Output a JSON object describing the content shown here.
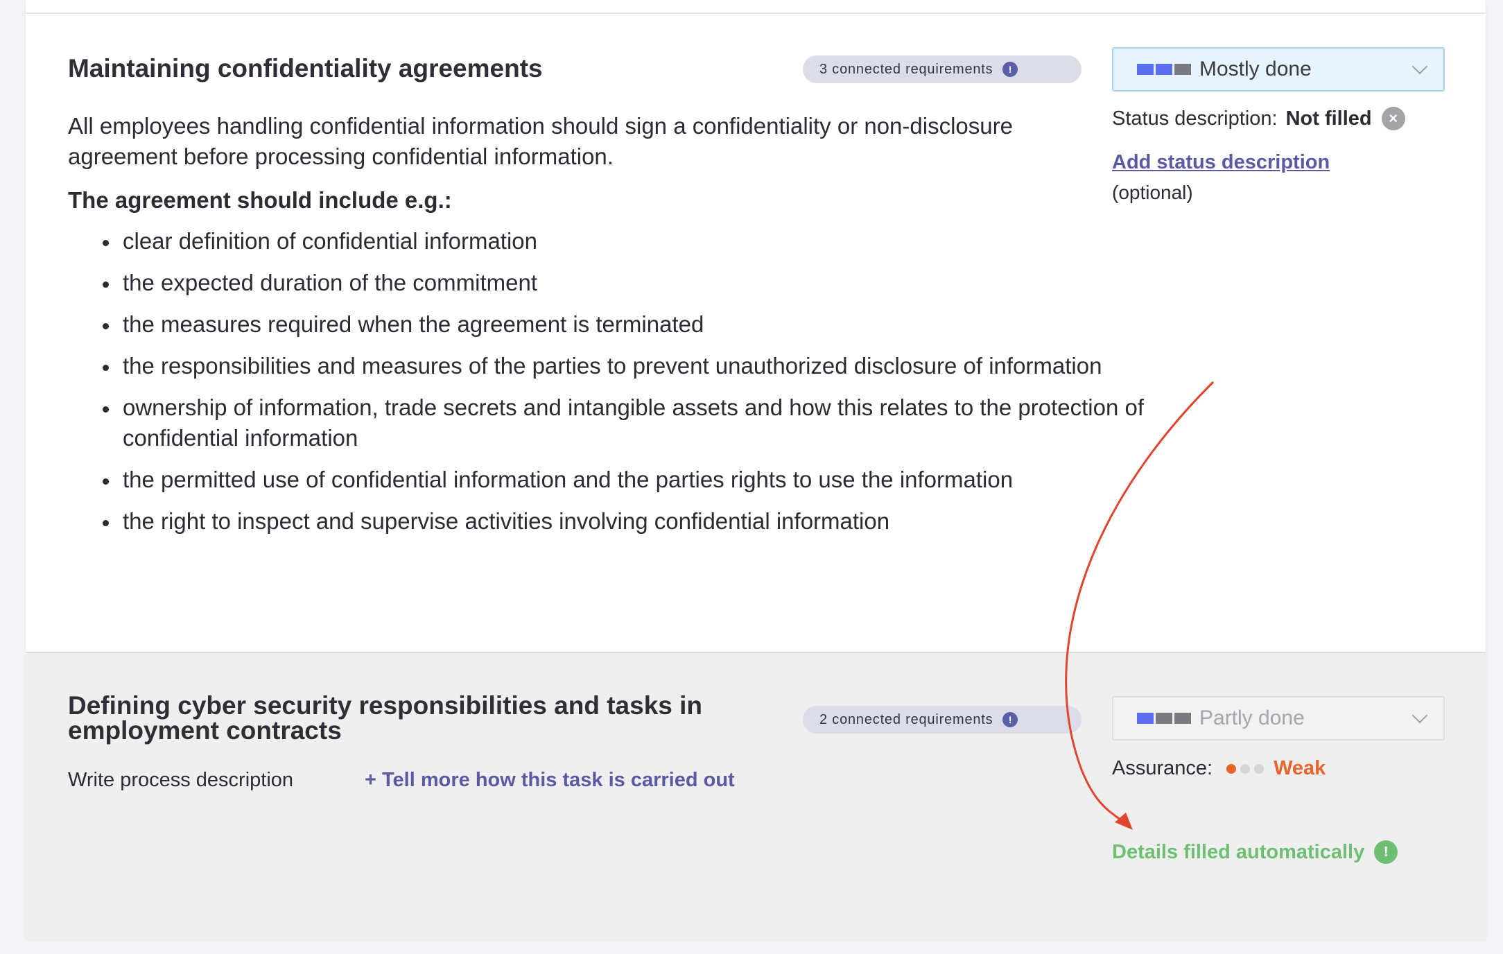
{
  "card1": {
    "title": "Maintaining confidentiality agreements",
    "badge_label": "3 connected requirements",
    "badge_icon": "!",
    "description": "All employees handling confidential information should sign a confidentiality or non-disclosure agreement before processing confidential information.",
    "subheading": "The agreement should include e.g.:",
    "bullets": [
      "clear definition of confidential information",
      "the expected duration of the commitment",
      "the measures required when the agreement is terminated",
      "the responsibilities and measures of the parties to prevent unauthorized disclosure of information",
      "ownership of information, trade secrets and intangible assets and how this relates to the protection of confidential information",
      "the permitted use of confidential information and the parties rights to use the information",
      "the right to inspect and supervise activities involving confidential information"
    ],
    "status": {
      "value": "Mostly done",
      "bar_colors": [
        "#5b6ef0",
        "#5b6ef0",
        "#7a7a80"
      ],
      "description_label": "Status description:",
      "description_value": "Not filled",
      "clear_icon": "×",
      "add_link": "Add status description",
      "optional": "(optional)"
    }
  },
  "card2": {
    "title": "Defining cyber security responsibilities and tasks in employment contracts",
    "badge_label": "2 connected requirements",
    "badge_icon": "!",
    "task_label": "Write process description",
    "tell_more_link": "+ Tell more how this task is carried out",
    "status": {
      "value": "Partly done",
      "bar_colors": [
        "#5b6ef0",
        "#7a7a80",
        "#7a7a80"
      ]
    },
    "assurance_label": "Assurance:",
    "assurance_value": "Weak",
    "assurance_dots": [
      "#e7652a",
      "#d6d6da",
      "#d6d6da"
    ],
    "auto_filled_label": "Details filled automatically",
    "auto_filled_icon": "!"
  },
  "colors": {
    "accent_link": "#5a5aa3",
    "weak": "#e7652a",
    "success": "#6fbf73",
    "annotation_arrow": "#e0452e"
  }
}
